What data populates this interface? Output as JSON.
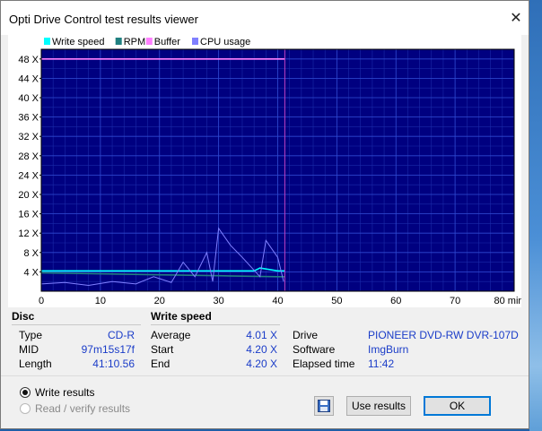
{
  "window": {
    "title": "Opti Drive Control test results viewer"
  },
  "legend": [
    {
      "label": "Write speed",
      "color": "#00ffff"
    },
    {
      "label": "RPM",
      "color": "#208080"
    },
    {
      "label": "Buffer",
      "color": "#ff80ff"
    },
    {
      "label": "CPU usage",
      "color": "#8080ff"
    }
  ],
  "chart_data": {
    "type": "line",
    "x_unit": "min",
    "xlim": [
      0,
      80
    ],
    "ylim": [
      0,
      50
    ],
    "x_ticks": [
      "0",
      "10",
      "20",
      "30",
      "40",
      "50",
      "60",
      "70",
      "80 min"
    ],
    "y_ticks": [
      "4 X",
      "8 X",
      "12 X",
      "16 X",
      "20 X",
      "24 X",
      "28 X",
      "32 X",
      "36 X",
      "40 X",
      "44 X",
      "48 X"
    ],
    "end_marker_x": 41.2,
    "series": [
      {
        "name": "Write speed",
        "x": [
          0,
          10,
          20,
          30,
          36,
          37,
          40,
          41.2
        ],
        "values": [
          4.2,
          4.2,
          4.2,
          4.2,
          4.2,
          4.8,
          4.2,
          4.2
        ]
      },
      {
        "name": "RPM",
        "x": [
          0,
          10,
          20,
          30,
          40,
          41.2
        ],
        "values": [
          3.8,
          3.6,
          3.4,
          3.2,
          3.0,
          3.0
        ]
      },
      {
        "name": "Buffer",
        "x": [
          0,
          10,
          20,
          30,
          40,
          41.2
        ],
        "values": [
          48,
          48,
          48,
          48,
          48,
          48
        ]
      },
      {
        "name": "CPU usage",
        "x": [
          0,
          4,
          8,
          12,
          16,
          19,
          22,
          24,
          26,
          28,
          29,
          30,
          32,
          34,
          37,
          38,
          40,
          41
        ],
        "values": [
          1.5,
          1.8,
          1.2,
          2.0,
          1.5,
          3.0,
          1.8,
          6.0,
          3.0,
          8.0,
          2.0,
          13.0,
          9.5,
          7.0,
          3.0,
          10.5,
          7.0,
          2.0
        ]
      }
    ]
  },
  "disc": {
    "header": "Disc",
    "rows": [
      {
        "label": "Type",
        "value": "CD-R"
      },
      {
        "label": "MID",
        "value": "97m15s17f"
      },
      {
        "label": "Length",
        "value": "41:10.56"
      }
    ]
  },
  "write_speed": {
    "header": "Write speed",
    "rows": [
      {
        "label": "Average",
        "value": "4.01 X"
      },
      {
        "label": "Start",
        "value": "4.20 X"
      },
      {
        "label": "End",
        "value": "4.20 X"
      }
    ]
  },
  "drive": {
    "rows": [
      {
        "label": "Drive",
        "value": "PIONEER  DVD-RW  DVR-107D"
      },
      {
        "label": "Software",
        "value": "ImgBurn"
      },
      {
        "label": "Elapsed time",
        "value": "11:42"
      }
    ]
  },
  "options": {
    "write_results": "Write results",
    "read_verify": "Read / verify results"
  },
  "buttons": {
    "save_icon": "floppy-disk-icon",
    "use_results": "Use results",
    "ok": "OK"
  }
}
